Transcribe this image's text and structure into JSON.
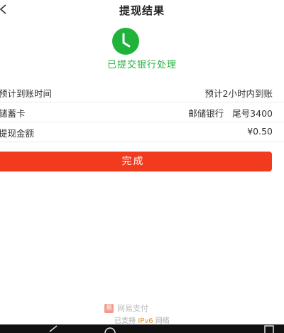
{
  "header": {
    "back_glyph": "<",
    "title": "提现结果"
  },
  "status": {
    "icon": "clock-check-icon",
    "text": "已提交银行处理",
    "color": "#1fb33b"
  },
  "rows": [
    {
      "label": "预计到账时间",
      "value": "预计2小时内到账"
    },
    {
      "label": "储蓄卡",
      "value": "邮储银行   尾号3400"
    },
    {
      "label": "提现金额",
      "value": "¥0.50"
    }
  ],
  "done_button": {
    "label": "完成",
    "color": "#f23a1e"
  },
  "footer": {
    "brand_name": "网易支付",
    "ipv6_prefix": "已支持",
    "ipv6_highlight": "IPv6",
    "ipv6_suffix": "网络"
  },
  "navbar": {
    "icons": [
      "back-nav-icon",
      "home-nav-icon",
      "recent-nav-icon"
    ]
  }
}
